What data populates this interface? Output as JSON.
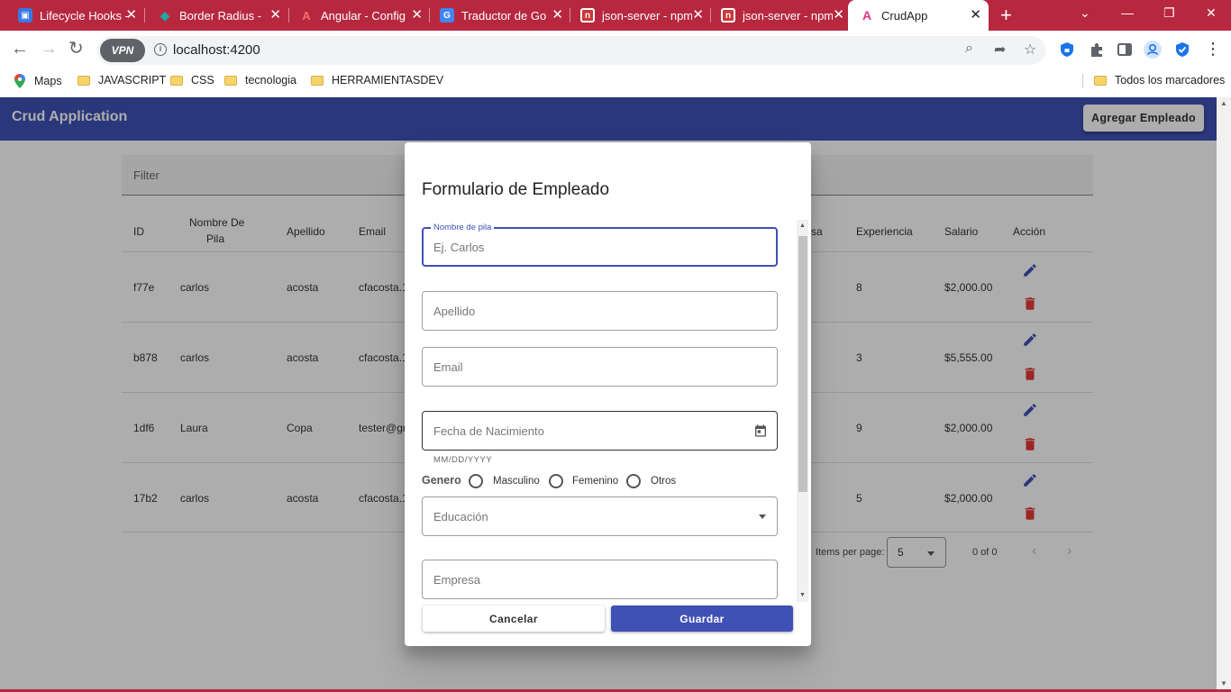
{
  "browser": {
    "tabs": [
      {
        "title": "Lifecycle Hooks - ",
        "icon": "lifecycle-favicon",
        "color": "#3b78e7"
      },
      {
        "title": "Border Radius - ",
        "icon": "diamond-favicon",
        "color": "#1fa8a0"
      },
      {
        "title": "Angular - Config",
        "icon": "angular-favicon",
        "color": "#dd0031"
      },
      {
        "title": "Traductor de Go",
        "icon": "google-translate-favicon",
        "color": "#4285f4"
      },
      {
        "title": "json-server - npm",
        "icon": "npm-favicon",
        "color": "#cb3837"
      },
      {
        "title": "json-server - npm",
        "icon": "npm-favicon",
        "color": "#cb3837"
      },
      {
        "title": "CrudApp",
        "icon": "angular-favicon",
        "color": "#e0357f"
      }
    ],
    "new_tab": "+",
    "vpn_label": "VPN",
    "url": "localhost:4200",
    "bookmarks": [
      {
        "label": "Maps",
        "icon": "maps-pin-icon"
      },
      {
        "label": "JAVASCRIPT",
        "icon": "folder-icon"
      },
      {
        "label": "CSS",
        "icon": "folder-icon"
      },
      {
        "label": "tecnologia",
        "icon": "folder-icon"
      },
      {
        "label": "HERRAMIENTASDEV",
        "icon": "folder-icon"
      }
    ],
    "all_bookmarks": "Todos los marcadores"
  },
  "app": {
    "title": "Crud Application",
    "add_button": "Agregar Empleado",
    "filter_placeholder": "Filter",
    "columns": {
      "id": "ID",
      "nombre_line1": "Nombre De",
      "nombre_line2": "Pila",
      "apellido": "Apellido",
      "email": "Email",
      "empresa_partial": "sa",
      "experiencia": "Experiencia",
      "salario": "Salario",
      "accion": "Acción"
    },
    "rows": [
      {
        "id": "f77e",
        "nombre": "carlos",
        "apellido": "acosta",
        "email": "cfacosta.1",
        "experiencia": "8",
        "salario": "$2,000.00"
      },
      {
        "id": "b878",
        "nombre": "carlos",
        "apellido": "acosta",
        "email": "cfacosta.1",
        "experiencia": "3",
        "salario": "$5,555.00"
      },
      {
        "id": "1df6",
        "nombre": "Laura",
        "apellido": "Copa",
        "email": "tester@gm",
        "experiencia": "9",
        "salario": "$2,000.00"
      },
      {
        "id": "17b2",
        "nombre": "carlos",
        "apellido": "acosta",
        "email": "cfacosta.1",
        "experiencia": "5",
        "salario": "$2,000.00"
      }
    ],
    "paginator": {
      "items_per_page_label": "Items per page:",
      "page_size": "5",
      "range": "0 of 0"
    }
  },
  "dialog": {
    "title": "Formulario de Empleado",
    "nombre_label": "Nombre de pila",
    "nombre_placeholder": "Ej. Carlos",
    "apellido_placeholder": "Apellido",
    "email_placeholder": "Email",
    "fecha_placeholder": "Fecha de Nacimiento",
    "fecha_hint": "MM/DD/YYYY",
    "genero_label": "Genero",
    "genero_options": [
      "Masculino",
      "Femenino",
      "Otros"
    ],
    "educacion_placeholder": "Educación",
    "empresa_placeholder": "Empresa",
    "cancel_label": "Cancelar",
    "save_label": "Guardar"
  },
  "colors": {
    "tabbar": "#b7283f",
    "primary": "#3f51b5",
    "edit_icon": "#3f51b5",
    "delete_icon": "#e53935"
  }
}
